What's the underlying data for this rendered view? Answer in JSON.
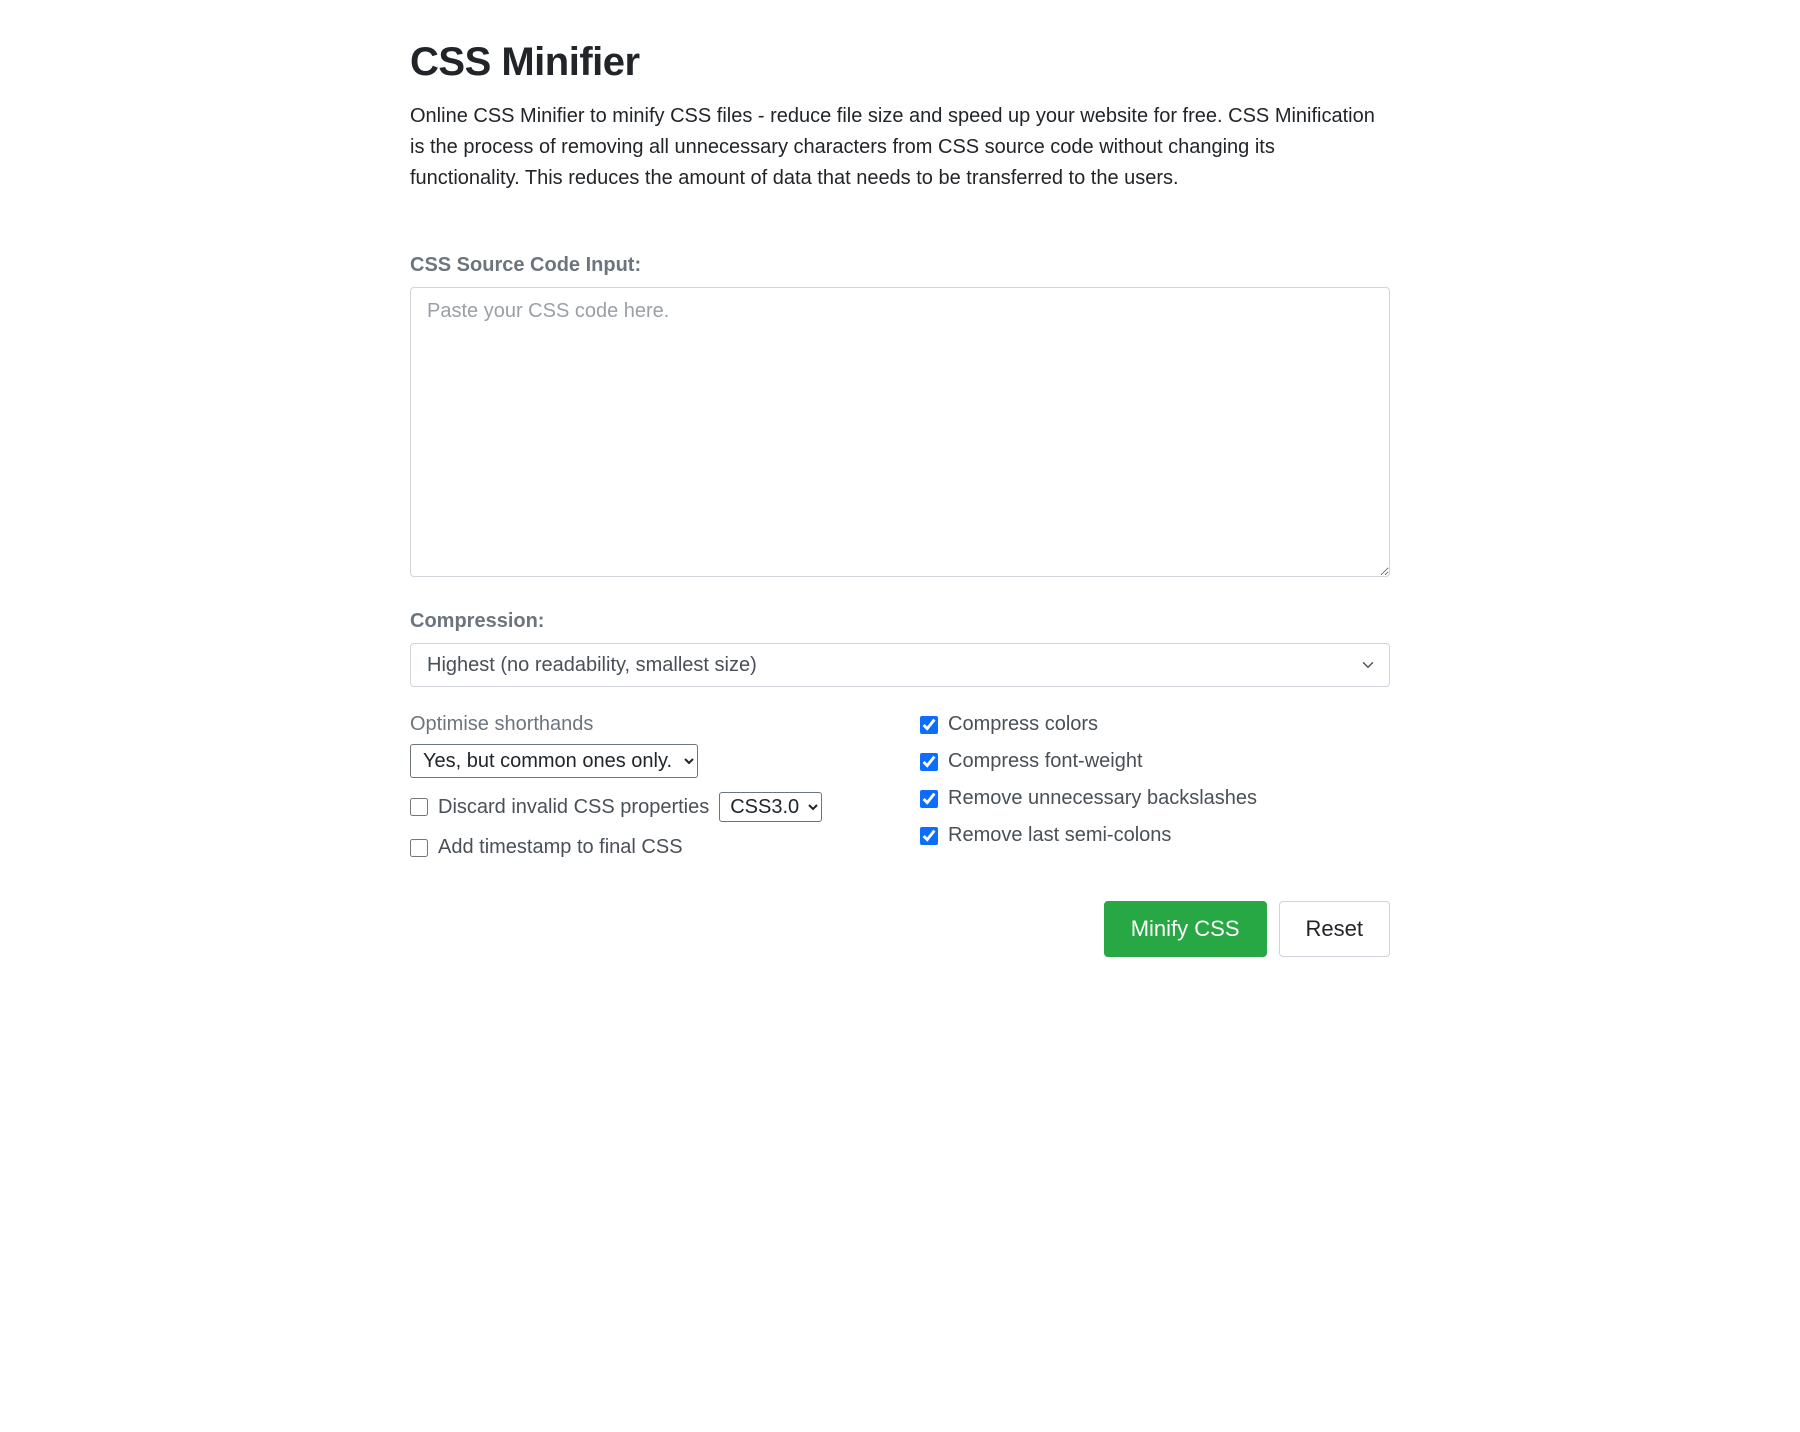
{
  "page": {
    "title": "CSS Minifier",
    "description": "Online CSS Minifier to minify CSS files - reduce file size and speed up your website for free. CSS Minification is the process of removing all unnecessary characters from CSS source code without changing its functionality. This reduces the amount of data that needs to be transferred to the users."
  },
  "input": {
    "label": "CSS Source Code Input:",
    "placeholder": "Paste your CSS code here.",
    "value": ""
  },
  "compression": {
    "label": "Compression:",
    "selected": "Highest (no readability, smallest size)"
  },
  "shorthands": {
    "label": "Optimise shorthands",
    "selected": "Yes, but common ones only."
  },
  "discard_invalid": {
    "label": "Discard invalid CSS properties",
    "checked": false,
    "version_selected": "CSS3.0"
  },
  "add_timestamp": {
    "label": "Add timestamp to final CSS",
    "checked": false
  },
  "compress_colors": {
    "label": "Compress colors",
    "checked": true
  },
  "compress_font_weight": {
    "label": "Compress font-weight",
    "checked": true
  },
  "remove_backslashes": {
    "label": "Remove unnecessary backslashes",
    "checked": true
  },
  "remove_semicolons": {
    "label": "Remove last semi-colons",
    "checked": true
  },
  "buttons": {
    "minify": "Minify CSS",
    "reset": "Reset"
  }
}
